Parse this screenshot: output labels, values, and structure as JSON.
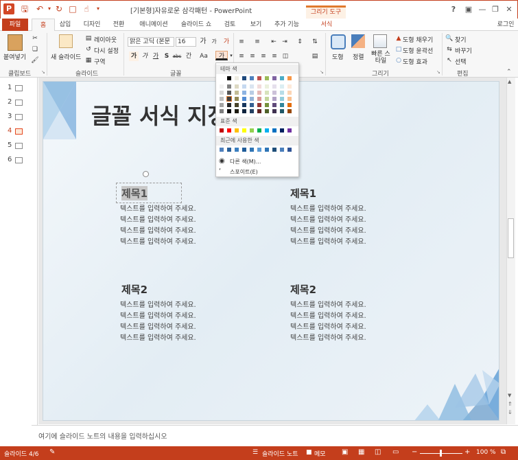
{
  "window": {
    "title": "[기본형]자유로운 삼각패턴 - PowerPoint",
    "context_tool": "그리기 도구",
    "help": "?",
    "login": "로그인"
  },
  "tabs": [
    "파일",
    "홈",
    "삽입",
    "디자인",
    "전환",
    "애니메이션",
    "슬라이드 쇼",
    "검토",
    "보기",
    "추가 기능",
    "서식"
  ],
  "ribbon": {
    "clipboard": {
      "paste": "붙여넣기",
      "group": "클립보드"
    },
    "slides": {
      "new_slide": "새 슬라이드",
      "layout": "레이아웃",
      "reset": "다시 설정",
      "section": "구역",
      "group": "슬라이드"
    },
    "font": {
      "font_name": "맑은 고딕 (본문",
      "font_size": "16",
      "group": "글꼴",
      "bold": "가",
      "italic": "가",
      "underline": "가",
      "shadow": "S",
      "strike": "abc",
      "spacing": "간",
      "case": "Aa",
      "color_letter": "가",
      "grow": "가",
      "shrink": "가",
      "clear": "가"
    },
    "paragraph": {
      "group": "단락"
    },
    "drawing": {
      "shapes": "도형",
      "arrange": "정렬",
      "quick_styles": "빠른 스타일",
      "fill": "도형 채우기",
      "outline": "도형 윤곽선",
      "effects": "도형 효과",
      "group": "그리기"
    },
    "editing": {
      "find": "찾기",
      "replace": "바꾸기",
      "select": "선택",
      "group": "편집"
    }
  },
  "color_popup": {
    "theme_title": "테마 색",
    "standard_title": "표준 색",
    "recent_title": "최근에 사용한 색",
    "more_colors": "다른 색(M)...",
    "eyedropper": "스포이트(E)",
    "theme_top": [
      "#ffffff",
      "#000000",
      "#eeece1",
      "#1f497d",
      "#4f81bd",
      "#c0504d",
      "#9bbb59",
      "#8064a2",
      "#4bacc6",
      "#f79646"
    ],
    "theme_shades": [
      [
        "#f2f2f2",
        "#7f7f7f",
        "#ddd9c3",
        "#c6d9f0",
        "#dbe5f1",
        "#f2dcdb",
        "#ebf1dd",
        "#e5e0ec",
        "#dbeef3",
        "#fdeada"
      ],
      [
        "#d8d8d8",
        "#595959",
        "#c4bd97",
        "#8db3e2",
        "#b8cce4",
        "#e5b9b7",
        "#d7e3bc",
        "#ccc1d9",
        "#b7dde8",
        "#fbd5b5"
      ],
      [
        "#bfbfbf",
        "#3f3f3f",
        "#938953",
        "#548dd4",
        "#95b3d7",
        "#d99694",
        "#c3d69b",
        "#b2a2c7",
        "#92cddc",
        "#fac08f"
      ],
      [
        "#a5a5a5",
        "#262626",
        "#494429",
        "#17365d",
        "#366092",
        "#953734",
        "#76923c",
        "#5f497a",
        "#31859b",
        "#e36c09"
      ],
      [
        "#7f7f7f",
        "#0c0c0c",
        "#1d1b10",
        "#0f243e",
        "#244061",
        "#632423",
        "#4f6128",
        "#3f3151",
        "#205867",
        "#974806"
      ]
    ],
    "standard": [
      "#c00000",
      "#ff0000",
      "#ffc000",
      "#ffff00",
      "#92d050",
      "#00b050",
      "#00b0f0",
      "#0070c0",
      "#002060",
      "#7030a0"
    ],
    "recent": [
      "#4f81bd",
      "#2a6099",
      "#3c7fbf",
      "#1f5c99",
      "#2f75b5",
      "#5b9bd5",
      "#2e75b6",
      "#1f4e79",
      "#4a7ebb",
      "#305496"
    ]
  },
  "thumbnails": [
    "1",
    "2",
    "3",
    "4",
    "5",
    "6"
  ],
  "slide": {
    "title": "글꼴 서식 지정",
    "blocks": [
      {
        "heading": "제목1",
        "lines": [
          "텍스트를 입력하여 주세요.",
          "텍스트를 입력하여 주세요.",
          "텍스트를 입력하여 주세요.",
          "텍스트를 입력하여 주세요."
        ]
      },
      {
        "heading": "제목1",
        "lines": [
          "텍스트를 입력하여 주세요.",
          "텍스트를 입력하여 주세요.",
          "텍스트를 입력하여 주세요.",
          "텍스트를 입력하여 주세요."
        ]
      },
      {
        "heading": "제목2",
        "lines": [
          "텍스트를 입력하여 주세요.",
          "텍스트를 입력하여 주세요.",
          "텍스트를 입력하여 주세요.",
          "텍스트를 입력하여 주세요."
        ]
      },
      {
        "heading": "제목2",
        "lines": [
          "텍스트를 입력하여 주세요.",
          "텍스트를 입력하여 주세요.",
          "텍스트를 입력하여 주세요.",
          "텍스트를 입력하여 주세요."
        ]
      }
    ]
  },
  "notes_placeholder": "여기에 슬라이드 노트의 내용을 입력하십시오",
  "status": {
    "slide_count": "슬라이드 4/6",
    "notes": "슬라이드 노트",
    "comments": "메모",
    "zoom": "100 %"
  },
  "colors": {
    "accent": "#c43e1c",
    "selected_thumb": "#e5461e"
  }
}
